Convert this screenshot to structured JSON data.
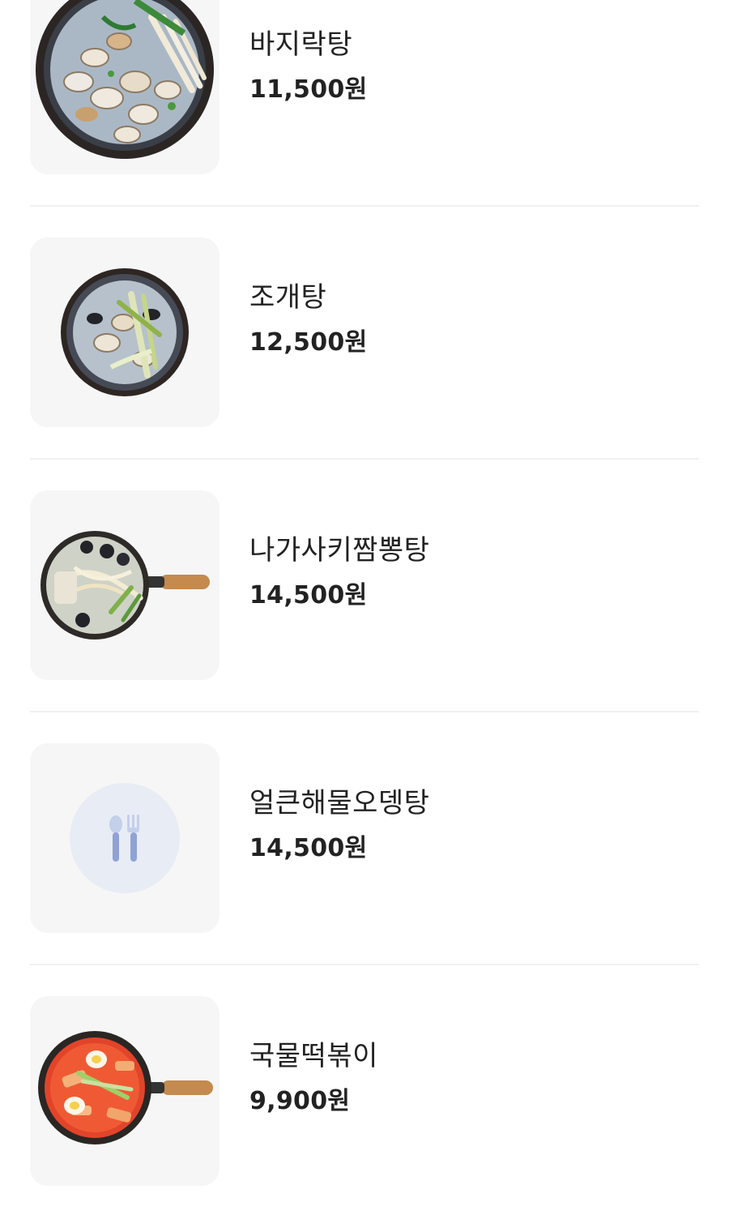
{
  "menu": {
    "items": [
      {
        "name": "바지락탕",
        "price": "11,500원",
        "image": "clam-soup-photo"
      },
      {
        "name": "조개탕",
        "price": "12,500원",
        "image": "shellfish-soup-photo"
      },
      {
        "name": "나가사키짬뽕탕",
        "price": "14,500원",
        "image": "nagasaki-jjamppong-photo"
      },
      {
        "name": "얼큰해물오뎅탕",
        "price": "14,500원",
        "image": "utensils-placeholder-icon"
      },
      {
        "name": "국물떡볶이",
        "price": "9,900원",
        "image": "tteokbokki-photo"
      }
    ]
  },
  "colors": {
    "thumb_bg": "#f6f6f6",
    "divider": "#f0f0f0",
    "placeholder_circle": "#e8ecf4",
    "placeholder_icon": "#8fa2d6"
  }
}
